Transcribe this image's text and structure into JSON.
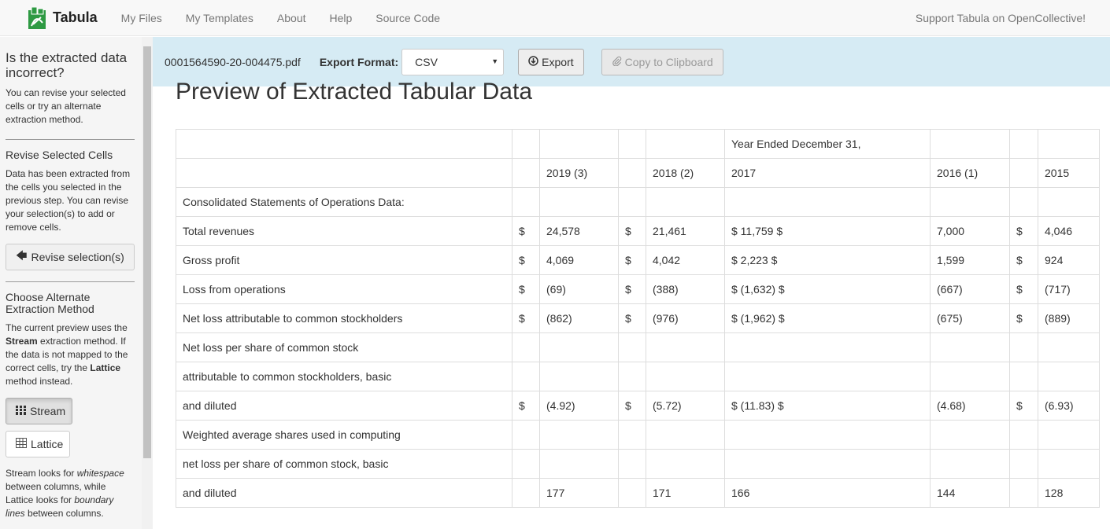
{
  "nav": {
    "brand": "Tabula",
    "links": [
      "My Files",
      "My Templates",
      "About",
      "Help",
      "Source Code"
    ],
    "support": "Support Tabula on OpenCollective!"
  },
  "sidebar": {
    "title": "Is the extracted data incorrect?",
    "intro": "You can revise your selected cells or try an alternate extraction method.",
    "revise_head": "Revise Selected Cells",
    "revise_text": "Data has been extracted from the cells you selected in the previous step. You can revise your selection(s) to add or remove cells.",
    "revise_button": "Revise selection(s)",
    "method_head": "Choose Alternate Extraction Method",
    "method_text_1": "The current preview uses the ",
    "method_current": "Stream",
    "method_text_2": " extraction method. If the data is not mapped to the correct cells, try the ",
    "method_alt": "Lattice",
    "method_text_3": " method instead.",
    "stream_button": "Stream",
    "lattice_button": "Lattice",
    "foot_1": "Stream looks for ",
    "foot_ws": "whitespace",
    "foot_2": " between columns, while Lattice looks for ",
    "foot_bl": "boundary lines",
    "foot_3": " between columns."
  },
  "toolbar": {
    "filename": "0001564590-20-004475.pdf",
    "format_label": "Export Format:",
    "format_value": "CSV",
    "export_button": "Export",
    "copy_button": "Copy to Clipboard"
  },
  "main": {
    "title": "Preview of Extracted Tabular Data",
    "rows": [
      [
        "",
        "",
        "",
        "",
        "",
        "Year Ended December 31,",
        "",
        "",
        ""
      ],
      [
        "",
        "",
        "2019 (3)",
        "",
        "2018 (2)",
        "2017",
        "2016 (1)",
        "",
        "2015"
      ],
      [
        "Consolidated Statements of Operations Data:",
        "",
        "",
        "",
        "",
        "",
        "",
        "",
        ""
      ],
      [
        "Total revenues",
        "$",
        "24,578",
        "$",
        "21,461",
        "$ 11,759 $",
        "7,000",
        "$",
        "4,046"
      ],
      [
        "Gross profit",
        "$",
        "4,069",
        "$",
        "4,042",
        "$ 2,223 $",
        "1,599",
        "$",
        "924"
      ],
      [
        "Loss from operations",
        "$",
        "(69)",
        "$",
        "(388)",
        "$ (1,632) $",
        "(667)",
        "$",
        "(717)"
      ],
      [
        "Net loss attributable to common stockholders",
        "$",
        "(862)",
        "$",
        "(976)",
        "$ (1,962) $",
        "(675)",
        "$",
        "(889)"
      ],
      [
        "Net loss per share of common stock",
        "",
        "",
        "",
        "",
        "",
        "",
        "",
        ""
      ],
      [
        "attributable to common stockholders, basic",
        "",
        "",
        "",
        "",
        "",
        "",
        "",
        ""
      ],
      [
        "and diluted",
        "$",
        "(4.92)",
        "$",
        "(5.72)",
        "$ (11.83) $",
        "(4.68)",
        "$",
        "(6.93)"
      ],
      [
        "Weighted average shares used in computing",
        "",
        "",
        "",
        "",
        "",
        "",
        "",
        ""
      ],
      [
        "net loss per share of common stock, basic",
        "",
        "",
        "",
        "",
        "",
        "",
        "",
        ""
      ],
      [
        "and diluted",
        "",
        "177",
        "",
        "171",
        "166",
        "144",
        "",
        "128"
      ]
    ]
  }
}
